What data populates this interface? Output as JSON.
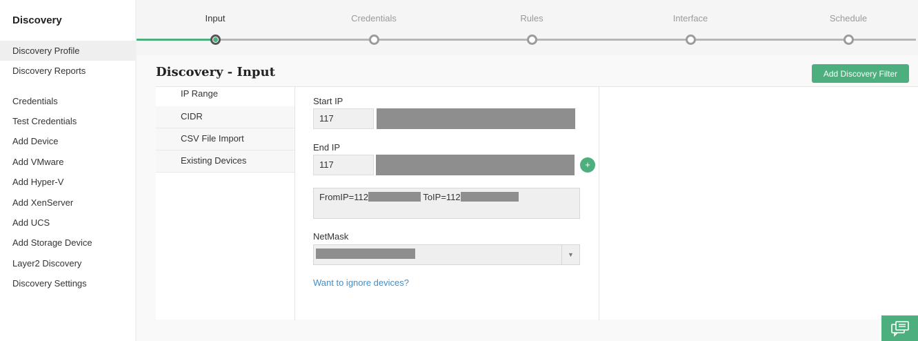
{
  "sidebar": {
    "title": "Discovery",
    "items": [
      {
        "label": "Discovery Profile",
        "active": true
      },
      {
        "label": "Discovery Reports"
      },
      {
        "label": "Credentials"
      },
      {
        "label": "Test Credentials"
      },
      {
        "label": "Add Device"
      },
      {
        "label": "Add VMware"
      },
      {
        "label": "Add Hyper-V"
      },
      {
        "label": "Add XenServer"
      },
      {
        "label": "Add UCS"
      },
      {
        "label": "Add Storage Device"
      },
      {
        "label": "Layer2 Discovery"
      },
      {
        "label": "Discovery Settings"
      }
    ]
  },
  "stepper": {
    "steps": [
      "Input",
      "Credentials",
      "Rules",
      "Interface",
      "Schedule"
    ],
    "active_step": "Input"
  },
  "header": {
    "title": "Discovery - Input",
    "add_filter_label": "Add Discovery Filter"
  },
  "methods": {
    "items": [
      "IP Range",
      "CIDR",
      "CSV File Import",
      "Existing Devices"
    ],
    "active": "IP Range"
  },
  "form": {
    "start_ip_label": "Start IP",
    "start_ip_first_octet": "117",
    "end_ip_label": "End IP",
    "end_ip_first_octet": "117",
    "add_label": "+",
    "range_from_prefix": "FromIP=112",
    "range_to_prefix": "ToIP=112",
    "netmask_label": "NetMask",
    "ignore_link": "Want to ignore devices?"
  },
  "icons": {
    "chat": "chat-icon",
    "dropdown": "chevron-down-icon"
  },
  "colors": {
    "accent": "#4caf7d",
    "link": "#3a8fd0",
    "redaction": "#8e8e8e"
  }
}
